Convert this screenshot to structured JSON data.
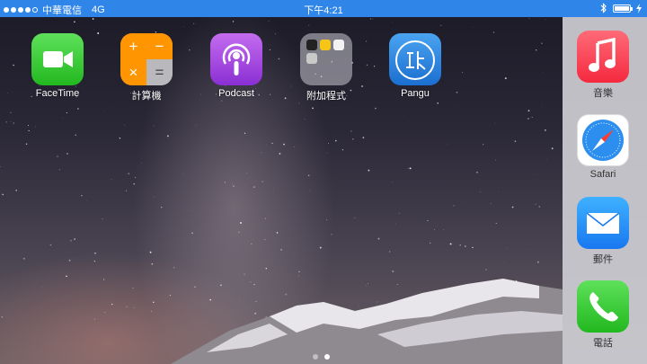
{
  "status_bar": {
    "carrier": "中華電信",
    "network": "4G",
    "time": "下午4:21",
    "signal_bars": 4,
    "battery_level": 1.0
  },
  "apps": [
    {
      "name": "facetime",
      "label": "FaceTime",
      "icon": "video-camera-icon"
    },
    {
      "name": "calculator",
      "label": "計算機",
      "icon": "calculator-icon"
    },
    {
      "name": "podcast",
      "label": "Podcast",
      "icon": "podcast-icon"
    },
    {
      "name": "folder",
      "label": "附加程式",
      "icon": "folder-icon"
    },
    {
      "name": "pangu",
      "label": "Pangu",
      "icon": "pangu-icon"
    }
  ],
  "calculator_symbols": [
    "+",
    "−",
    "×",
    "="
  ],
  "dock": [
    {
      "name": "music",
      "label": "音樂",
      "icon": "music-note-icon"
    },
    {
      "name": "safari",
      "label": "Safari",
      "icon": "compass-icon"
    },
    {
      "name": "mail",
      "label": "郵件",
      "icon": "envelope-icon"
    },
    {
      "name": "phone",
      "label": "電話",
      "icon": "phone-icon"
    }
  ],
  "page_indicator": {
    "count": 2,
    "active": 2
  },
  "colors": {
    "status_bar": "#2f86e8",
    "dock": "#cdcdd2"
  }
}
